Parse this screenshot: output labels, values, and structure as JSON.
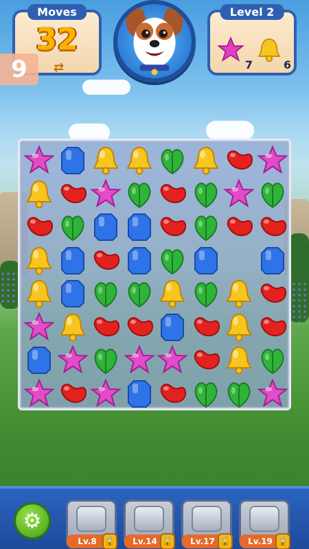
{
  "hud": {
    "moves_label": "Moves",
    "moves_value": "32",
    "level_label": "Level 2",
    "goals": [
      {
        "icon": "pink-star-candy",
        "count": "7"
      },
      {
        "icon": "yellow-bell-candy",
        "count": "6"
      }
    ],
    "badge": "9"
  },
  "board": {
    "cols": 8,
    "rows": 8,
    "grid": [
      [
        "star",
        "gem",
        "bell",
        "bell",
        "leaf",
        "bell",
        "bean",
        "star"
      ],
      [
        "bell",
        "bean",
        "star",
        "leaf",
        "bean",
        "leaf",
        "star",
        "leaf"
      ],
      [
        "bean",
        "leaf",
        "gem",
        "gem",
        "bean",
        "leaf",
        "bean",
        "bean"
      ],
      [
        "bell",
        "gem",
        "bean",
        "gem",
        "leaf",
        "gem",
        "",
        "gem"
      ],
      [
        "bell",
        "gem",
        "leaf",
        "leaf",
        "bell",
        "leaf",
        "bell",
        "bean"
      ],
      [
        "star",
        "bell",
        "bean",
        "bean",
        "gem",
        "bean",
        "bell",
        "bean"
      ],
      [
        "gem",
        "star",
        "leaf",
        "star",
        "star",
        "bean",
        "bell",
        "leaf"
      ],
      [
        "star",
        "bean",
        "star",
        "gem",
        "bean",
        "leaf",
        "leaf",
        "star"
      ]
    ]
  },
  "bottom": {
    "boosters": [
      {
        "label": "Lv.8"
      },
      {
        "label": "Lv.14"
      },
      {
        "label": "Lv.17"
      },
      {
        "label": "Lv.19"
      }
    ]
  }
}
